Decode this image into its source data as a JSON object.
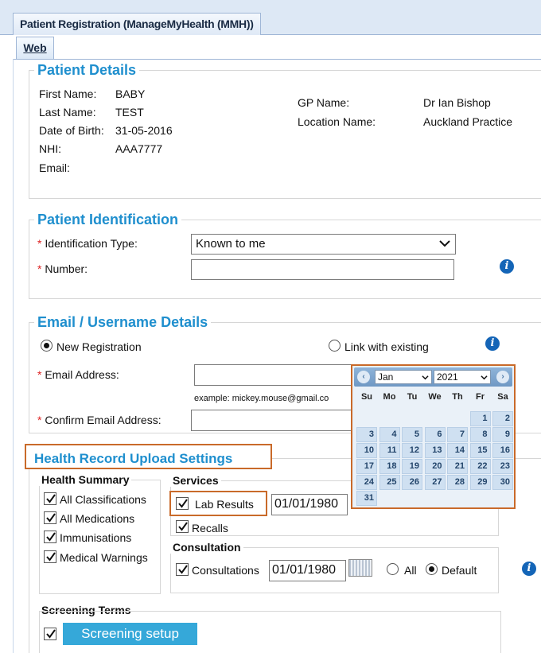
{
  "window": {
    "tab_title": "Patient Registration (ManageMyHealth (MMH))",
    "subtab": "Web"
  },
  "patient_details": {
    "legend": "Patient Details",
    "first_name_label": "First Name:",
    "first_name": "BABY",
    "last_name_label": "Last Name:",
    "last_name": "TEST",
    "dob_label": "Date of Birth:",
    "dob": "31-05-2016",
    "nhi_label": "NHI:",
    "nhi": "AAA7777",
    "email_label": "Email:",
    "gp_name_label": "GP Name:",
    "gp_name": "Dr Ian Bishop",
    "location_label": "Location Name:",
    "location": "Auckland Practice"
  },
  "identification": {
    "legend": "Patient Identification",
    "type_label": "Identification Type:",
    "type_value": "Known to me",
    "number_label": "Number:",
    "number_value": ""
  },
  "email_details": {
    "legend": "Email / Username Details",
    "new_registration": "New Registration",
    "link_existing": "Link with existing",
    "email_label": "Email Address:",
    "email_value": "",
    "example": "example: mickey.mouse@gmail.co",
    "confirm_label": "Confirm Email Address:",
    "confirm_value": ""
  },
  "upload_settings": {
    "legend": "Health Record Upload Settings",
    "health_summary": {
      "title": "Health Summary",
      "items": [
        "All Classifications",
        "All Medications",
        "Immunisations",
        "Medical Warnings"
      ]
    },
    "services": {
      "title": "Services",
      "lab_results": "Lab Results",
      "lab_date": "01/01/1980",
      "recalls": "Recalls"
    },
    "consultation": {
      "title": "Consultation",
      "label": "Consultations",
      "date": "01/01/1980",
      "all": "All",
      "default": "Default"
    },
    "screening": {
      "title": "Screening Terms",
      "button": "Screening setup"
    }
  },
  "calendar": {
    "month": "Jan",
    "year": "2021",
    "prev": "‹",
    "next": "›",
    "dow": [
      "Su",
      "Mo",
      "Tu",
      "We",
      "Th",
      "Fr",
      "Sa"
    ],
    "weeks": [
      [
        "",
        "",
        "",
        "",
        "",
        "1",
        "2"
      ],
      [
        "3",
        "4",
        "5",
        "6",
        "7",
        "8",
        "9"
      ],
      [
        "10",
        "11",
        "12",
        "13",
        "14",
        "15",
        "16"
      ],
      [
        "17",
        "18",
        "19",
        "20",
        "21",
        "22",
        "23"
      ],
      [
        "24",
        "25",
        "26",
        "27",
        "28",
        "29",
        "30"
      ],
      [
        "31",
        "",
        "",
        "",
        "",
        "",
        ""
      ]
    ]
  },
  "colors": {
    "legend": "#1f8fce",
    "highlight_border": "#c96a2a",
    "calendar_day": "#cfe0f1",
    "button": "#35a8d9"
  },
  "icons": {
    "info": "info-icon",
    "checkbox": "check-icon",
    "calendar": "calendar-icon",
    "dropdown": "chevron-down-icon"
  }
}
